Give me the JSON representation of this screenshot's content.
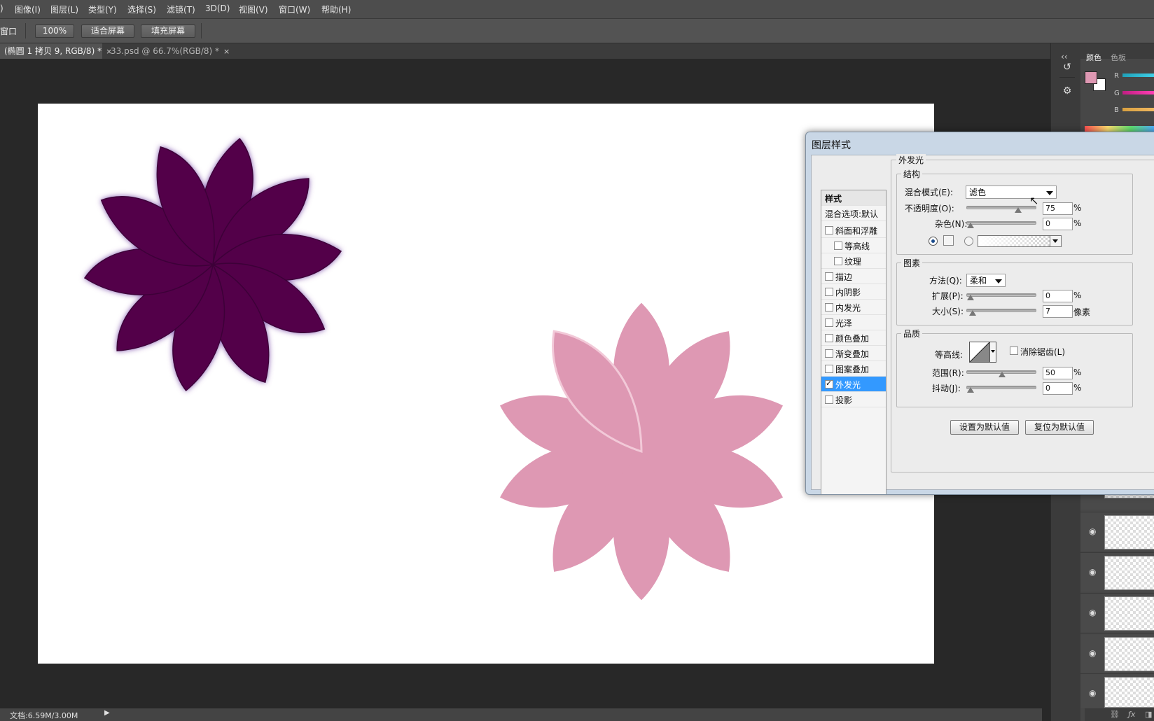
{
  "menu": [
    "图像(I)",
    "图层(L)",
    "类型(Y)",
    "选择(S)",
    "滤镜(T)",
    "3D(D)",
    "视图(V)",
    "窗口(W)",
    "帮助(H)"
  ],
  "menu_fragment": ")",
  "options": {
    "left_label": "窗口",
    "zoom_btn": "100%",
    "fit_btn": "适合屏幕",
    "fill_btn": "填充屏幕"
  },
  "tabs": [
    {
      "label": "(椭圆 1 拷贝 9, RGB/8) *"
    },
    {
      "label": "33.psd @ 66.7%(RGB/8) *"
    }
  ],
  "tab_close": "×",
  "status": {
    "doc": "文档:6.59M/3.00M"
  },
  "color_panel": {
    "tabs": [
      "颜色",
      "色板"
    ],
    "channels": [
      "R",
      "G",
      "B"
    ]
  },
  "colors": {
    "flower_dark": "#52004a",
    "flower_pink": "#de98b3",
    "accent_blue": "#3399ff"
  },
  "dialog": {
    "title": "图层样式",
    "styles_header": "样式",
    "blend_default": "混合选项:默认",
    "items": [
      {
        "label": "斜面和浮雕",
        "checked": false
      },
      {
        "label": "等高线",
        "checked": false
      },
      {
        "label": "纹理",
        "checked": false
      },
      {
        "label": "描边",
        "checked": false
      },
      {
        "label": "内阴影",
        "checked": false
      },
      {
        "label": "内发光",
        "checked": false
      },
      {
        "label": "光泽",
        "checked": false
      },
      {
        "label": "颜色叠加",
        "checked": false
      },
      {
        "label": "渐变叠加",
        "checked": false
      },
      {
        "label": "图案叠加",
        "checked": false
      },
      {
        "label": "外发光",
        "checked": true
      },
      {
        "label": "投影",
        "checked": false
      }
    ],
    "section_title": "外发光",
    "structure": {
      "title": "结构",
      "blend_label": "混合模式(E):",
      "blend_value": "滤色",
      "opacity_label": "不透明度(O):",
      "opacity": "75",
      "opacity_fraction": 0.75,
      "noise_label": "杂色(N):",
      "noise": "0",
      "noise_fraction": 0
    },
    "elements": {
      "title": "图素",
      "method_label": "方法(Q):",
      "method_value": "柔和",
      "spread_label": "扩展(P):",
      "spread": "0",
      "spread_fraction": 0,
      "size_label": "大小(S):",
      "size": "7",
      "size_unit": "像素",
      "size_fraction": 0.03
    },
    "quality": {
      "title": "品质",
      "contour_label": "等高线:",
      "antialias_label": "消除锯齿(L)",
      "range_label": "范围(R):",
      "range": "50",
      "range_fraction": 0.5,
      "jitter_label": "抖动(J):",
      "jitter": "0",
      "jitter_fraction": 0
    },
    "percent": "%",
    "set_default": "设置为默认值",
    "reset_default": "复位为默认值"
  }
}
